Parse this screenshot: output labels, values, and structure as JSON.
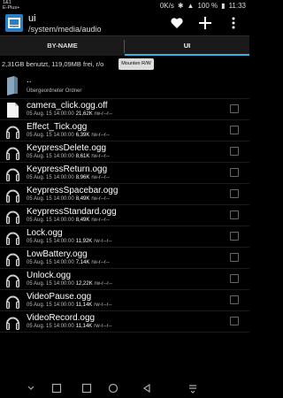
{
  "status": {
    "carrier_line1": "1&1",
    "carrier_line2": "E-Plus+",
    "speed": "0K/s",
    "battery": "100 %",
    "time": "11:33"
  },
  "app": {
    "title": "ui",
    "path": "/system/media/audio"
  },
  "tabs": [
    {
      "label": "BY-NAME"
    },
    {
      "label": "UI"
    }
  ],
  "info": {
    "storage": "2,31GB benutzt, 119,09MB frei, r/o",
    "mount_label": "Mounten R/W"
  },
  "parent": {
    "name": "..",
    "label": "Übergeordneter Ordner"
  },
  "files": [
    {
      "name": "camera_click.ogg.off",
      "date": "05 Aug. 15 14:00:00",
      "size": "21,62K",
      "perm": "rw-r--r--",
      "icon": "file-icon"
    },
    {
      "name": "Effect_Tick.ogg",
      "date": "05 Aug. 15 14:00:00",
      "size": "6,39K",
      "perm": "rw-r--r--",
      "icon": "headphones-icon"
    },
    {
      "name": "KeypressDelete.ogg",
      "date": "05 Aug. 15 14:00:00",
      "size": "8,61K",
      "perm": "rw-r--r--",
      "icon": "headphones-icon"
    },
    {
      "name": "KeypressReturn.ogg",
      "date": "05 Aug. 15 14:00:00",
      "size": "8,96K",
      "perm": "rw-r--r--",
      "icon": "headphones-icon"
    },
    {
      "name": "KeypressSpacebar.ogg",
      "date": "05 Aug. 15 14:00:00",
      "size": "8,49K",
      "perm": "rw-r--r--",
      "icon": "headphones-icon"
    },
    {
      "name": "KeypressStandard.ogg",
      "date": "05 Aug. 15 14:00:00",
      "size": "8,49K",
      "perm": "rw-r--r--",
      "icon": "headphones-icon"
    },
    {
      "name": "Lock.ogg",
      "date": "05 Aug. 15 14:00:00",
      "size": "11,92K",
      "perm": "rw-r--r--",
      "icon": "headphones-icon"
    },
    {
      "name": "LowBattery.ogg",
      "date": "05 Aug. 15 14:00:00",
      "size": "7,14K",
      "perm": "rw-r--r--",
      "icon": "headphones-icon"
    },
    {
      "name": "Unlock.ogg",
      "date": "05 Aug. 15 14:00:00",
      "size": "12,22K",
      "perm": "rw-r--r--",
      "icon": "headphones-icon"
    },
    {
      "name": "VideoPause.ogg",
      "date": "05 Aug. 15 14:00:00",
      "size": "11,14K",
      "perm": "rw-r--r--",
      "icon": "headphones-icon"
    },
    {
      "name": "VideoRecord.ogg",
      "date": "05 Aug. 15 14:00:00",
      "size": "11,14K",
      "perm": "rw-r--r--",
      "icon": "headphones-icon"
    }
  ],
  "colors": {
    "accent": "#33b5e5",
    "folder": "#6f8fa8",
    "app_icon": "#2a7fc4"
  }
}
